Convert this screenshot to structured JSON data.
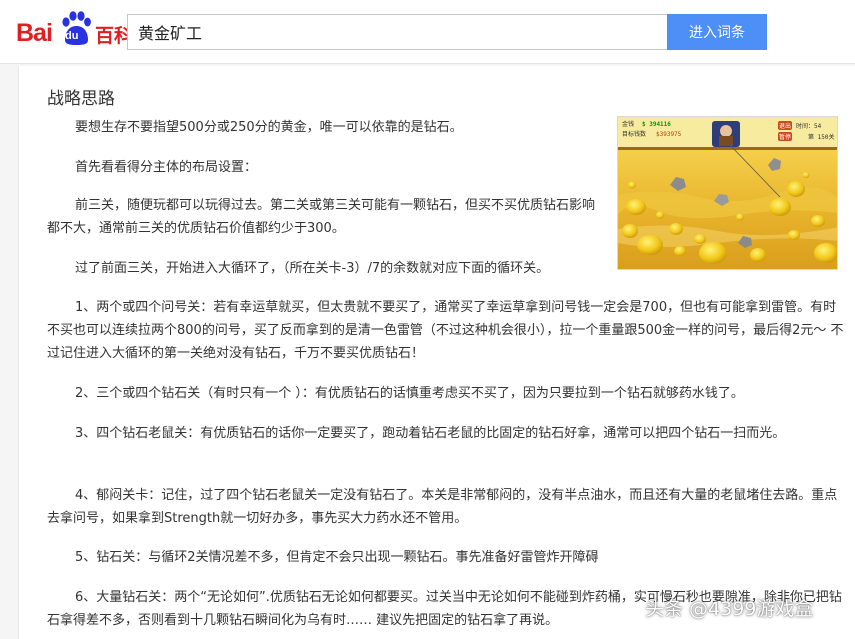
{
  "header": {
    "logo_text": "Bai",
    "logo_du": "du",
    "logo_baike": "百科",
    "search_value": "黄金矿工",
    "button_label": "进入词条"
  },
  "article": {
    "section_title": "战略思路",
    "paragraphs": [
      "要想生存不要指望500分或250分的黄金，唯一可以依靠的是钻石。",
      "首先看看得分主体的布局设置：",
      "前三关，随便玩都可以玩得过去。第二关或第三关可能有一颗钻石，但买不买优质钻石影响都不大，通常前三关的优质钻石价值都约少于300。",
      "过了前面三关，开始进入大循环了，（所在关卡-3）/7的余数就对应下面的循环关。",
      "1、两个或四个问号关：若有幸运草就买，但太贵就不要买了，通常买了幸运草拿到问号钱一定会是700，但也有可能拿到雷管。有时不买也可以连续拉两个800的问号，买了反而拿到的是清一色雷管（不过这种机会很小），拉一个重量跟500金一样的问号，最后得2元～ 不过记住进入大循环的第一关绝对没有钻石，千万不要买优质钻石！",
      "2、三个或四个钻石关（有时只有一个 ）：有优质钻石的话慎重考虑买不买了，因为只要拉到一个钻石就够药水钱了。",
      "3、四个钻石老鼠关：有优质钻石的话你一定要买了，跑动着钻石老鼠的比固定的钻石好拿，通常可以把四个钻石一扫而光。",
      "4、郁闷关卡：记住，过了四个钻石老鼠关一定没有钻石了。本关是非常郁闷的，没有半点油水，而且还有大量的老鼠堵住去路。重点去拿问号，如果拿到Strength就一切好办多，事先买大力药水还不管用。",
      "5、钻石关：与循环2关情况差不多，但肯定不会只出现一颗钻石。事先准备好雷管炸开障碍",
      "6、大量钻石关：两个“无论如何”.优质钻石无论如何都要买。过关当中无论如何不能碰到炸药桶，实可慢石秒也要隙准，除非你已把钻石拿得差不多，否则看到十几颗钻石瞬间化为乌有时…… 建议先把固定的钻石拿了再说。"
    ]
  },
  "game_image": {
    "money_label": "金钱",
    "money_value": "$ 394116",
    "goal_label": "目标钱数",
    "goal_value": "$393975",
    "btn_top": "退出",
    "time_label": "时间：54",
    "btn_bottom": "暂停",
    "level_label": "第 150关"
  },
  "watermark": "头条 @4399游戏盒",
  "colors": {
    "brand_red": "#de2022",
    "brand_blue": "#2932e1",
    "button_blue": "#4e8ef7"
  }
}
